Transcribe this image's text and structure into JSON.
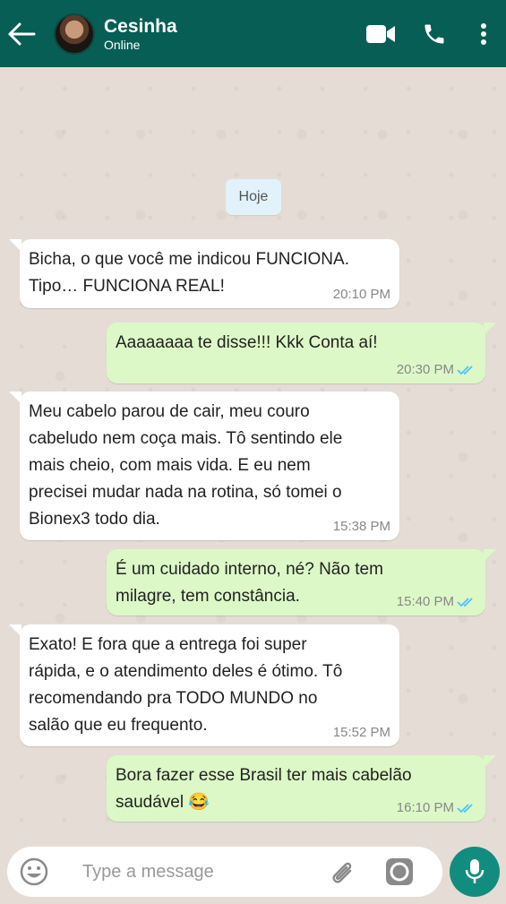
{
  "header": {
    "contact_name": "Cesinha",
    "status": "Online",
    "icons": [
      "back-arrow-icon",
      "avatar",
      "video-call-icon",
      "phone-icon",
      "more-options-icon"
    ]
  },
  "chat": {
    "date_label": "Hoje",
    "messages": [
      {
        "direction": "in",
        "text": "Bicha, o que você me indicou FUNCIONA.\nTipo… FUNCIONA REAL!",
        "time": "20:10 PM"
      },
      {
        "direction": "out",
        "text": "Aaaaaaaa te disse!!! Kkk Conta aí!",
        "time": "20:30 PM",
        "read": true
      },
      {
        "direction": "in",
        "text": "Meu cabelo parou de cair, meu couro\ncabeludo nem coça mais. Tô sentindo ele\nmais cheio, com mais vida. E eu nem\nprecisei mudar nada na rotina, só tomei o\nBionex3 todo dia.",
        "time": "15:38 PM"
      },
      {
        "direction": "out",
        "text": "É um cuidado interno, né? Não tem\nmilagre, tem constância.",
        "time": "15:40 PM",
        "read": true
      },
      {
        "direction": "in",
        "text": "Exato! E fora que a entrega foi super\nrápida, e o atendimento deles é ótimo. Tô\nrecomendando pra TODO MUNDO no\nsalão que eu frequento.",
        "time": "15:52 PM"
      },
      {
        "direction": "out",
        "text": "Bora fazer esse Brasil ter mais cabelão\nsaudável 😂",
        "time": "16:10 PM",
        "read": true
      }
    ]
  },
  "composer": {
    "placeholder": "Type a message",
    "value": "",
    "icons": [
      "emoji-icon",
      "attach-icon",
      "camera-icon",
      "mic-icon"
    ]
  },
  "colors": {
    "header": "#075e54",
    "outgoing_bubble": "#dcf8c6",
    "incoming_bubble": "#ffffff",
    "chat_background": "#e5ddd5",
    "mic_button": "#128c7e",
    "read_ticks": "#4fc3f7"
  }
}
